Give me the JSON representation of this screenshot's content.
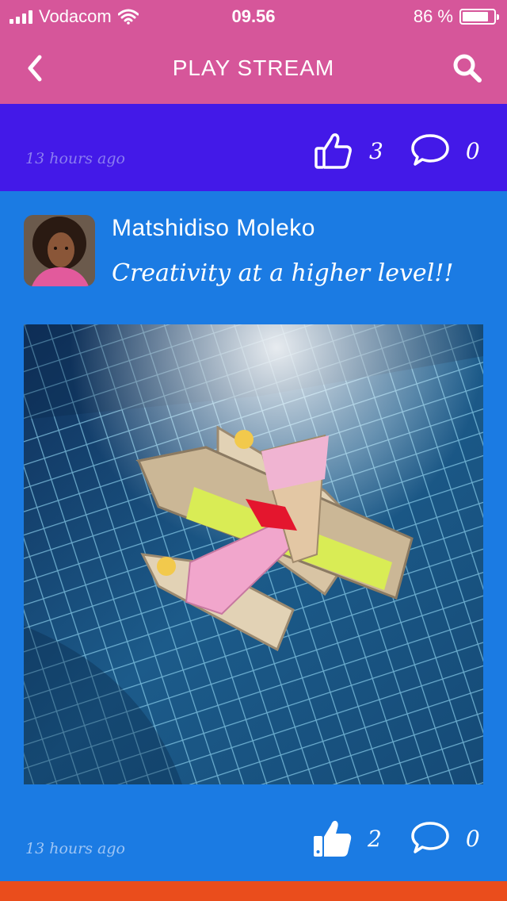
{
  "status_bar": {
    "carrier": "Vodacom",
    "time": "09.56",
    "battery_percent": "86 %",
    "battery_level": 0.86
  },
  "header": {
    "title": "PLAY STREAM",
    "back_icon": "chevron-left-icon",
    "search_icon": "search-icon"
  },
  "posts": [
    {
      "timestamp": "13 hours ago",
      "likes": "3",
      "comments": "0"
    },
    {
      "author": "Matshidiso Moleko",
      "caption": "Creativity at a higher level!!",
      "image_description_icon": "photo",
      "timestamp": "13 hours ago",
      "likes": "2",
      "comments": "0"
    }
  ],
  "colors": {
    "header": "#d6569a",
    "post1_bg": "#4319e8",
    "post2_bg": "#1b7be3",
    "next_post_bg": "#ea4d1c"
  }
}
